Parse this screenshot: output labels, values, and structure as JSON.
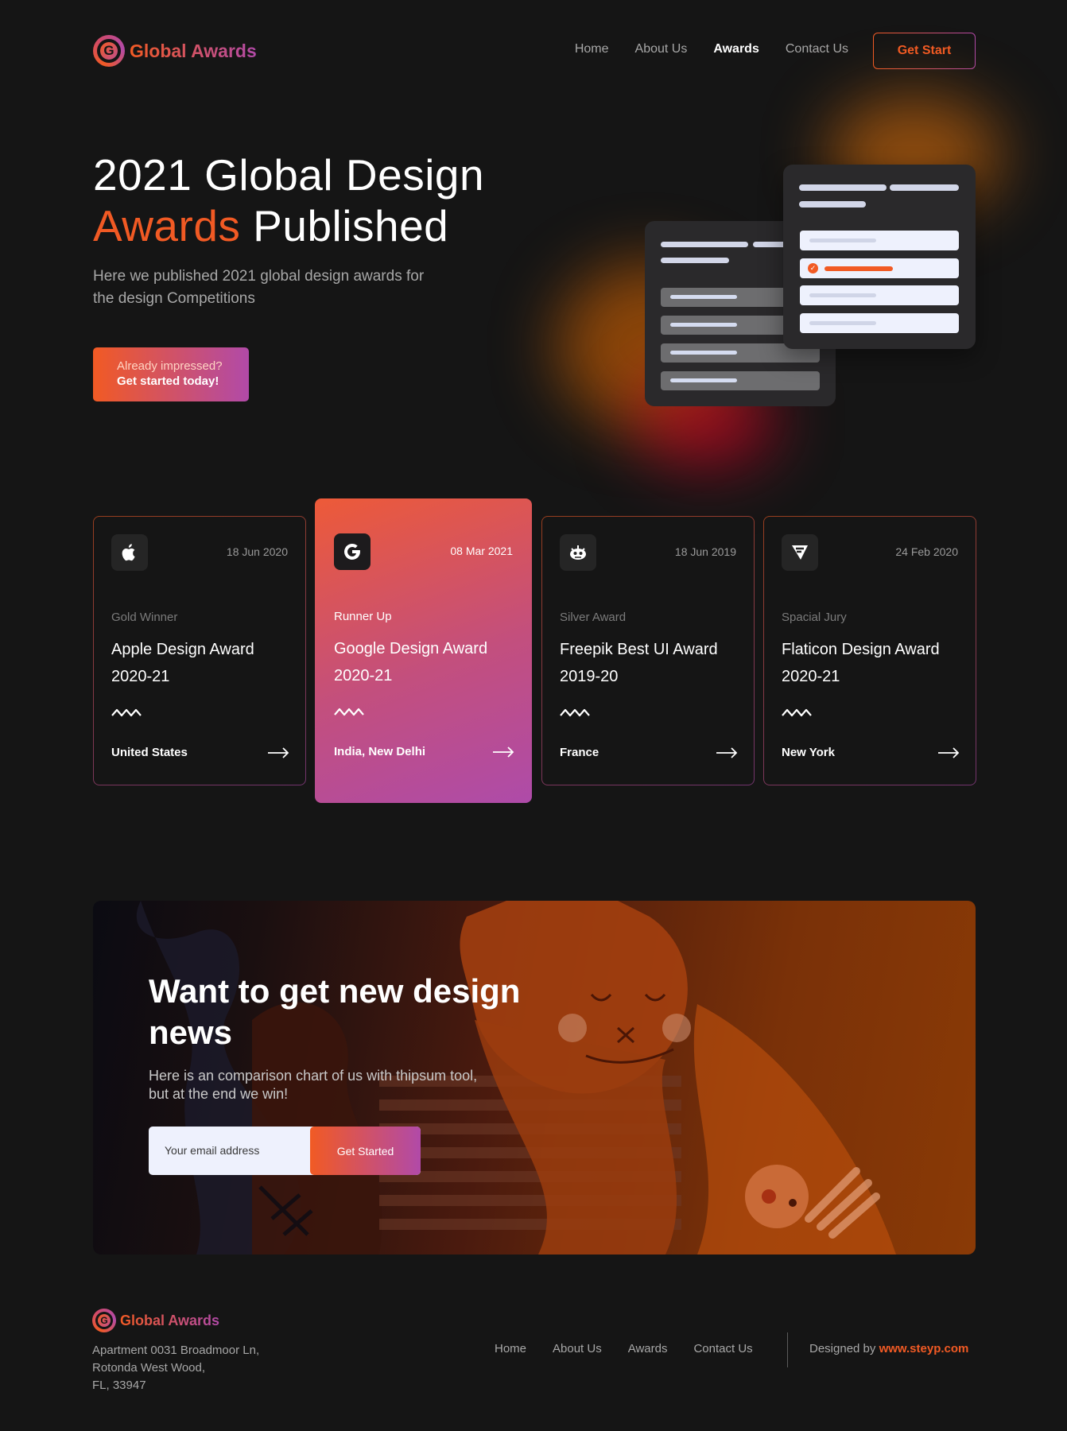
{
  "brand": {
    "name": "Global Awards",
    "logo_letter": "G"
  },
  "nav": {
    "items": [
      "Home",
      "About Us",
      "Awards",
      "Contact Us"
    ],
    "active": "Awards",
    "cta": "Get Start"
  },
  "hero": {
    "title_line1": "2021 Global Design",
    "title_highlight": "Awards",
    "title_rest": " Published",
    "subtitle": "Here we published 2021 global design awards for the design Competitions",
    "button_line1": "Already impressed?",
    "button_line2": "Get started today!"
  },
  "awards": [
    {
      "icon": "apple-icon",
      "date": "18 Jun 2020",
      "category": "Gold Winner",
      "name": "Apple Design Award 2020-21",
      "location": "United States"
    },
    {
      "icon": "google-icon",
      "date": "08 Mar 2021",
      "category": "Runner Up",
      "name": "Google Design Award 2020-21",
      "location": "India, New Delhi"
    },
    {
      "icon": "freepik-icon",
      "date": "18 Jun 2019",
      "category": "Silver Award",
      "name": "Freepik Best UI Award 2019-20",
      "location": "France"
    },
    {
      "icon": "flaticon-icon",
      "date": "24 Feb 2020",
      "category": "Spacial Jury",
      "name": "Flaticon Design Award 2020-21",
      "location": "New York"
    }
  ],
  "newsletter": {
    "title": "Want to get new design news",
    "subtitle": "Here is an comparison chart of us with thipsum tool, but at the end we win!",
    "placeholder": "Your email address",
    "button": "Get Started"
  },
  "footer": {
    "address_line1": "Apartment 0031 Broadmoor Ln,",
    "address_line2": "Rotonda West Wood,",
    "address_line3": "FL, 33947",
    "nav": [
      "Home",
      "About Us",
      "Awards",
      "Contact Us"
    ],
    "credit_prefix": "Designed by ",
    "credit_link": "www.steyp.com"
  },
  "colors": {
    "accent": "#f15a24",
    "accent2": "#b14aa8",
    "background": "#151515"
  }
}
